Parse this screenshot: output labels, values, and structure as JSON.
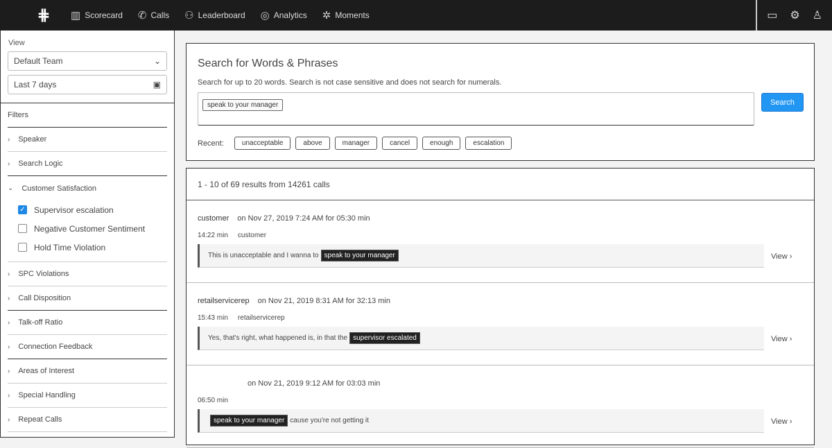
{
  "nav": {
    "items": [
      {
        "label": "Scorecard",
        "icon": "chart-icon"
      },
      {
        "label": "Calls",
        "icon": "phone-icon"
      },
      {
        "label": "Leaderboard",
        "icon": "users-icon"
      },
      {
        "label": "Analytics",
        "icon": "globe-icon"
      },
      {
        "label": "Moments",
        "icon": "sparkle-icon"
      }
    ]
  },
  "sidebar": {
    "view_label": "View",
    "team": "Default Team",
    "date_range": "Last 7 days",
    "filters_label": "Filters",
    "filters": [
      "Speaker",
      "Search Logic",
      "Customer Satisfaction"
    ],
    "checkboxes": [
      {
        "label": "Supervisor escalation",
        "checked": true
      },
      {
        "label": "Negative Customer Sentiment",
        "checked": false
      },
      {
        "label": "Hold Time Violation",
        "checked": false
      }
    ],
    "more_filters": [
      "SPC Violations",
      "Call Disposition",
      "Talk-off Ratio",
      "Connection Feedback",
      "Areas of Interest",
      "Special Handling",
      "Repeat Calls"
    ]
  },
  "search": {
    "title": "Search for Words & Phrases",
    "hint": "Search for up to 20 words. Search is not case sensitive and does not search for numerals.",
    "chip": "speak to your manager",
    "button": "Search",
    "recent_label": "Recent:",
    "recent": [
      "unacceptable",
      "above",
      "manager",
      "cancel",
      "enough",
      "escalation"
    ]
  },
  "results": {
    "count": "1 - 10 of 69 results from 14261 calls",
    "view_label": "View",
    "items": [
      {
        "who": "customer",
        "meta": "on Nov 27, 2019 7:24 AM for 05:30 min",
        "time": "14:22 min",
        "speaker": "customer",
        "before": "This is unacceptable and I wanna to",
        "highlight": "speak to your manager",
        "after": ""
      },
      {
        "who": "retailservicerep",
        "meta": "on Nov 21, 2019 8:31 AM for 32:13 min",
        "time": "15:43 min",
        "speaker": "retailservicerep",
        "before": "Yes, that's right, what happened is, in that the",
        "highlight": "supervisor escalated",
        "after": ""
      },
      {
        "who": "",
        "meta": "on Nov 21, 2019 9:12 AM for 03:03 min",
        "time": "06:50 min",
        "speaker": "",
        "before": "",
        "highlight": "speak to your manager",
        "after": "cause you're not getting it"
      }
    ]
  }
}
